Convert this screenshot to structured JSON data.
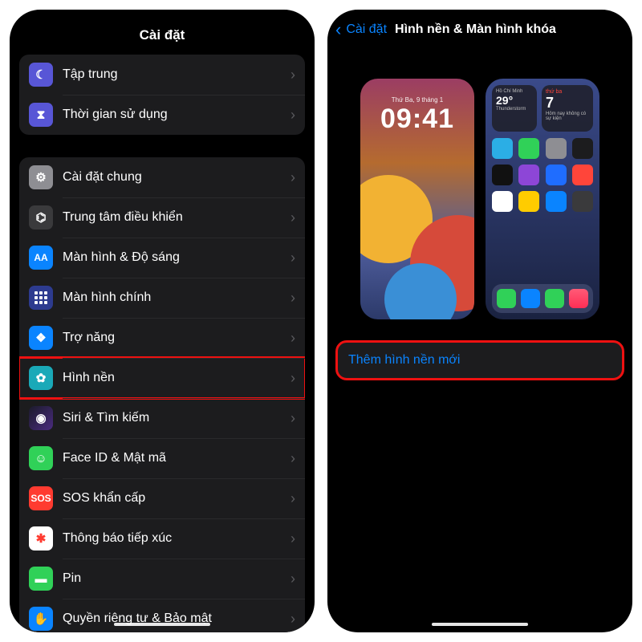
{
  "left": {
    "header_title": "Cài đặt",
    "group1": [
      {
        "name": "focus",
        "label": "Tập trung",
        "icon": "c-indigo",
        "glyph": "☾"
      },
      {
        "name": "screentime",
        "label": "Thời gian sử dụng",
        "icon": "c-hour",
        "glyph": "⧗"
      }
    ],
    "group2": [
      {
        "name": "general",
        "label": "Cài đặt chung",
        "icon": "c-gray",
        "glyph": "⚙"
      },
      {
        "name": "control-center",
        "label": "Trung tâm điều khiển",
        "icon": "c-ctrl",
        "glyph": "⌬"
      },
      {
        "name": "display",
        "label": "Màn hình & Độ sáng",
        "icon": "c-aa",
        "glyph": "AA"
      },
      {
        "name": "homescreen",
        "label": "Màn hình chính",
        "icon": "c-home",
        "glyph": "grid"
      },
      {
        "name": "accessibility",
        "label": "Trợ năng",
        "icon": "c-acc",
        "glyph": "❖"
      },
      {
        "name": "wallpaper",
        "label": "Hình nền",
        "icon": "c-wall",
        "glyph": "✿",
        "highlight": true
      },
      {
        "name": "siri",
        "label": "Siri & Tìm kiếm",
        "icon": "c-siri",
        "glyph": "◉"
      },
      {
        "name": "faceid",
        "label": "Face ID & Mật mã",
        "icon": "c-face",
        "glyph": "☺"
      },
      {
        "name": "sos",
        "label": "SOS khẩn cấp",
        "icon": "c-sos",
        "glyph": "SOS"
      },
      {
        "name": "exposure",
        "label": "Thông báo tiếp xúc",
        "icon": "c-exp",
        "glyph": "✱"
      },
      {
        "name": "battery",
        "label": "Pin",
        "icon": "c-batt",
        "glyph": "▬"
      },
      {
        "name": "privacy",
        "label": "Quyền riêng tư & Bảo mật",
        "icon": "c-priv",
        "glyph": "✋"
      }
    ]
  },
  "right": {
    "back_label": "Cài đặt",
    "header_title": "Hình nền & Màn hình khóa",
    "lock_preview": {
      "date": "Thứ Ba, 9 tháng 1",
      "time": "09:41"
    },
    "home_preview": {
      "weather_city": "Hồ Chí Minh",
      "weather_temp": "29°",
      "weather_cond": "Thunderstorm",
      "cal_day_label": "thứ ba",
      "cal_day_num": "7",
      "cal_note": "Hôm nay không có sự kiện"
    },
    "add_wallpaper_label": "Thêm hình nền mới"
  }
}
